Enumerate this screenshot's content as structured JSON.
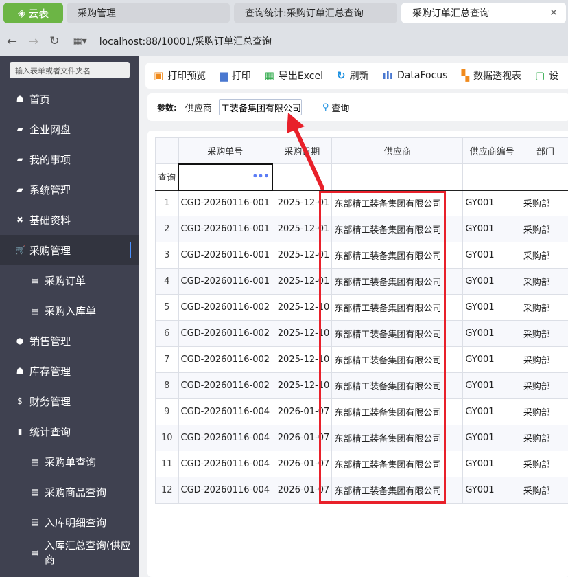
{
  "browser": {
    "logo": "云表",
    "tabs": [
      {
        "label": "采购管理"
      },
      {
        "label": "查询统计:采购订单汇总查询"
      },
      {
        "label": "采购订单汇总查询"
      }
    ],
    "url": "localhost:88/10001/采购订单汇总查询"
  },
  "sidebar": {
    "search_placeholder": "输入表单或者文件夹名",
    "items": [
      {
        "label": "首页",
        "icon": "home-icon"
      },
      {
        "label": "企业网盘",
        "icon": "folder-icon"
      },
      {
        "label": "我的事项",
        "icon": "folder-icon"
      },
      {
        "label": "系统管理",
        "icon": "folder-icon"
      },
      {
        "label": "基础资料",
        "icon": "tools-icon"
      },
      {
        "label": "采购管理",
        "icon": "cart-icon",
        "active": true
      },
      {
        "label": "采购订单",
        "icon": "doc-icon",
        "sub": true
      },
      {
        "label": "采购入库单",
        "icon": "doc-icon",
        "sub": true
      },
      {
        "label": "销售管理",
        "icon": "user-icon"
      },
      {
        "label": "库存管理",
        "icon": "home-icon"
      },
      {
        "label": "财务管理",
        "icon": "money-icon"
      },
      {
        "label": "统计查询",
        "icon": "chart-icon"
      },
      {
        "label": "采购单查询",
        "icon": "doc-icon",
        "sub": true
      },
      {
        "label": "采购商品查询",
        "icon": "doc-icon",
        "sub": true
      },
      {
        "label": "入库明细查询",
        "icon": "doc-icon",
        "sub": true
      },
      {
        "label": "入库汇总查询(供应商",
        "icon": "doc-icon",
        "sub": true
      }
    ]
  },
  "toolbar": [
    {
      "label": "打印预览",
      "color": "#f08a1c"
    },
    {
      "label": "打印",
      "color": "#4a78d0"
    },
    {
      "label": "导出Excel",
      "color": "#2aa846"
    },
    {
      "label": "刷新",
      "color": "#1a8fe0"
    },
    {
      "label": "DataFocus",
      "color": "#4a78d0"
    },
    {
      "label": "数据透视表",
      "color": "#f08a1c"
    },
    {
      "label": "设",
      "color": "#2aa846"
    }
  ],
  "params": {
    "label": "参数:",
    "field_label": "供应商",
    "field_value": "工装备集团有限公司",
    "query_label": "查询"
  },
  "table": {
    "query_row_label": "查询",
    "columns": [
      "",
      "采购单号",
      "采购日期",
      "供应商",
      "供应商编号",
      "部门"
    ],
    "rows": [
      [
        "1",
        "CGD-20260116-001",
        "2025-12-01",
        "东部精工装备集团有限公司",
        "GY001",
        "采购部"
      ],
      [
        "2",
        "CGD-20260116-001",
        "2025-12-01",
        "东部精工装备集团有限公司",
        "GY001",
        "采购部"
      ],
      [
        "3",
        "CGD-20260116-001",
        "2025-12-01",
        "东部精工装备集团有限公司",
        "GY001",
        "采购部"
      ],
      [
        "4",
        "CGD-20260116-001",
        "2025-12-01",
        "东部精工装备集团有限公司",
        "GY001",
        "采购部"
      ],
      [
        "5",
        "CGD-20260116-002",
        "2025-12-10",
        "东部精工装备集团有限公司",
        "GY001",
        "采购部"
      ],
      [
        "6",
        "CGD-20260116-002",
        "2025-12-10",
        "东部精工装备集团有限公司",
        "GY001",
        "采购部"
      ],
      [
        "7",
        "CGD-20260116-002",
        "2025-12-10",
        "东部精工装备集团有限公司",
        "GY001",
        "采购部"
      ],
      [
        "8",
        "CGD-20260116-002",
        "2025-12-10",
        "东部精工装备集团有限公司",
        "GY001",
        "采购部"
      ],
      [
        "9",
        "CGD-20260116-004",
        "2026-01-07",
        "东部精工装备集团有限公司",
        "GY001",
        "采购部"
      ],
      [
        "10",
        "CGD-20260116-004",
        "2026-01-07",
        "东部精工装备集团有限公司",
        "GY001",
        "采购部"
      ],
      [
        "11",
        "CGD-20260116-004",
        "2026-01-07",
        "东部精工装备集团有限公司",
        "GY001",
        "采购部"
      ],
      [
        "12",
        "CGD-20260116-004",
        "2026-01-07",
        "东部精工装备集团有限公司",
        "GY001",
        "采购部"
      ]
    ]
  },
  "annotation_color": "#e8202a"
}
